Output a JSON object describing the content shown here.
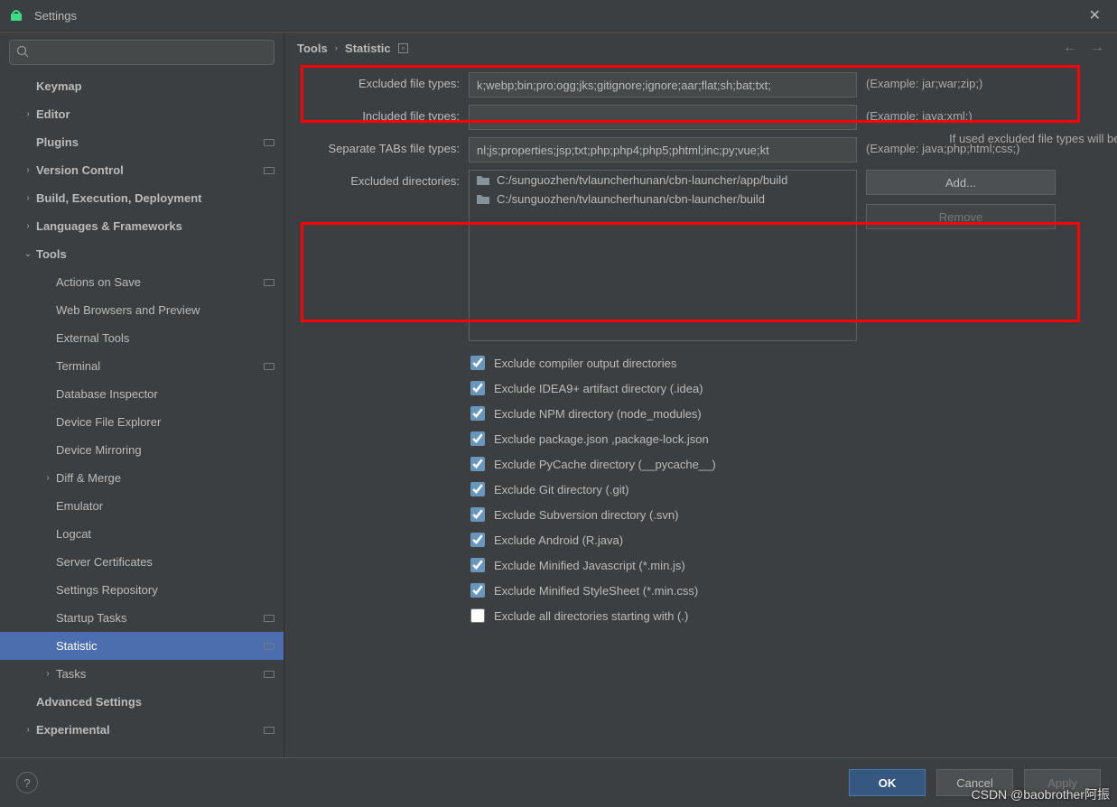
{
  "window": {
    "title": "Settings",
    "close_glyph": "✕"
  },
  "search": {
    "placeholder": ""
  },
  "sidebar": [
    {
      "label": "Keymap",
      "depth": 1,
      "bold": true,
      "chev": ""
    },
    {
      "label": "Editor",
      "depth": 1,
      "bold": true,
      "chev": "›"
    },
    {
      "label": "Plugins",
      "depth": 1,
      "bold": true,
      "chev": "",
      "badge": true
    },
    {
      "label": "Version Control",
      "depth": 1,
      "bold": true,
      "chev": "›",
      "badge": true
    },
    {
      "label": "Build, Execution, Deployment",
      "depth": 1,
      "bold": true,
      "chev": "›"
    },
    {
      "label": "Languages & Frameworks",
      "depth": 1,
      "bold": true,
      "chev": "›"
    },
    {
      "label": "Tools",
      "depth": 1,
      "bold": true,
      "chev": "⌄"
    },
    {
      "label": "Actions on Save",
      "depth": 2,
      "chev": "",
      "badge": true
    },
    {
      "label": "Web Browsers and Preview",
      "depth": 2,
      "chev": ""
    },
    {
      "label": "External Tools",
      "depth": 2,
      "chev": ""
    },
    {
      "label": "Terminal",
      "depth": 2,
      "chev": "",
      "badge": true
    },
    {
      "label": "Database Inspector",
      "depth": 2,
      "chev": ""
    },
    {
      "label": "Device File Explorer",
      "depth": 2,
      "chev": ""
    },
    {
      "label": "Device Mirroring",
      "depth": 2,
      "chev": ""
    },
    {
      "label": "Diff & Merge",
      "depth": 2,
      "chev": "›"
    },
    {
      "label": "Emulator",
      "depth": 2,
      "chev": ""
    },
    {
      "label": "Logcat",
      "depth": 2,
      "chev": ""
    },
    {
      "label": "Server Certificates",
      "depth": 2,
      "chev": ""
    },
    {
      "label": "Settings Repository",
      "depth": 2,
      "chev": ""
    },
    {
      "label": "Startup Tasks",
      "depth": 2,
      "chev": "",
      "badge": true
    },
    {
      "label": "Statistic",
      "depth": 2,
      "chev": "",
      "badge": true,
      "selected": true
    },
    {
      "label": "Tasks",
      "depth": 2,
      "chev": "›",
      "badge": true
    },
    {
      "label": "Advanced Settings",
      "depth": 1,
      "bold": true,
      "chev": ""
    },
    {
      "label": "Experimental",
      "depth": 1,
      "bold": true,
      "chev": "›",
      "badge": true
    }
  ],
  "breadcrumb": {
    "root": "Tools",
    "leaf": "Statistic"
  },
  "form": {
    "excluded_types": {
      "label": "Excluded file types:",
      "value": "k;webp;bin;pro;ogg;jks;gitignore;ignore;aar;flat;sh;bat;txt;",
      "example": "(Example: jar;war;zip;)"
    },
    "included_types": {
      "label": "Included file types:",
      "value": "",
      "example": "(Example: java;xml;)"
    },
    "included_hint": "If used excluded file types will be i",
    "separate_tabs": {
      "label": "Separate TABs file types:",
      "value": "nl;js;properties;jsp;txt;php;php4;php5;phtml;inc;py;vue;kt",
      "example": "(Example: java;php;html;css;)"
    },
    "excluded_dirs": {
      "label": "Excluded directories:",
      "items": [
        "C:/sunguozhen/tvlauncherhunan/cbn-launcher/app/build",
        "C:/sunguozhen/tvlauncherhunan/cbn-launcher/build"
      ]
    },
    "add_btn": "Add...",
    "remove_btn": "Remove"
  },
  "checks": [
    {
      "label": "Exclude compiler output directories",
      "checked": true
    },
    {
      "label": "Exclude IDEA9+ artifact directory (.idea)",
      "checked": true
    },
    {
      "label": "Exclude NPM directory (node_modules)",
      "checked": true
    },
    {
      "label": "Exclude package.json ,package-lock.json",
      "checked": true
    },
    {
      "label": "Exclude PyCache directory (__pycache__)",
      "checked": true
    },
    {
      "label": "Exclude Git directory (.git)",
      "checked": true
    },
    {
      "label": "Exclude Subversion directory (.svn)",
      "checked": true
    },
    {
      "label": "Exclude Android (R.java)",
      "checked": true
    },
    {
      "label": "Exclude Minified Javascript (*.min.js)",
      "checked": true
    },
    {
      "label": "Exclude Minified StyleSheet (*.min.css)",
      "checked": true
    },
    {
      "label": "Exclude all directories starting with (.)",
      "checked": false
    }
  ],
  "footer": {
    "help": "?",
    "ok": "OK",
    "cancel": "Cancel",
    "apply": "Apply"
  },
  "watermark": "CSDN @baobrother阿振"
}
